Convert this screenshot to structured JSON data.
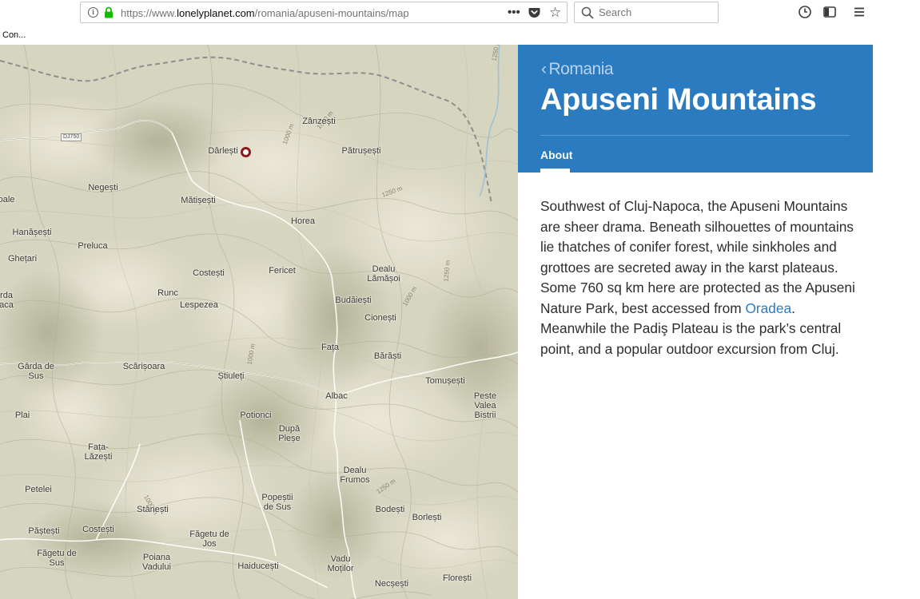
{
  "browser": {
    "url_prefix": "https://www.",
    "url_domain": "lonelyplanet.com",
    "url_path": "/romania/apuseni-mountains/map",
    "more_label": "•••",
    "search_placeholder": "Search",
    "bookmark_label": "Con..."
  },
  "map": {
    "road_label": "DJ750",
    "contour_labels": [
      "1000 m",
      "1000 m",
      "1250 m",
      "1250 m",
      "1250 m",
      "1000 m",
      "1000 m",
      "1250 m",
      "1000 m"
    ],
    "places": [
      "Zânzești",
      "Dârlești",
      "Pătrușești",
      "Negești",
      "Mătișești",
      "oale",
      "Horea",
      "Hanășești",
      "Preluca",
      "Ghețari",
      "Costești",
      "Fericet",
      "Dealu",
      "Lămășoi",
      "Runc",
      "Lespezea",
      "Budăiești",
      "Cionești",
      "rda",
      "aca",
      "Fața",
      "Bărăști",
      "Gârda de",
      "Sus",
      "Scărișoara",
      "Știuleți",
      "Tomușești",
      "Albac",
      "Peste",
      "Valea",
      "Bistrii",
      "Plai",
      "Potionci",
      "După",
      "Pleșe",
      "Fața-",
      "Lăzești",
      "Dealu",
      "Frumos",
      "Petelei",
      "Popeștii",
      "de Sus",
      "Stănești",
      "Bodești",
      "Borlești",
      "Păștești",
      "Costești",
      "Făgetu de",
      "Jos",
      "Făgetu de",
      "Sus",
      "Poiana",
      "Vadului",
      "Haiducești",
      "Vadu",
      "Moților",
      "Necșești",
      "Florești"
    ]
  },
  "panel": {
    "back_label": "Romania",
    "title": "Apuseni Mountains",
    "tab_about": "About",
    "desc_part1": "Southwest of Cluj-Napoca, the Apuseni Mountains are sheer drama. Beneath silhouettes of mountains lie thatches of conifer forest, while sinkholes and grottoes are secreted away in the karst plateaus. Some 760 sq km here are protected as the Apuseni Nature Park, best accessed from ",
    "desc_link": "Oradea",
    "desc_part2": ". Meanwhile the Padiş Plateau is the park’s central point, and a popular outdoor excursion from Cluj."
  },
  "colors": {
    "header_blue": "#2b7bc0",
    "marker_red": "#8b1a1a",
    "map_terrain": "#d8d6c2"
  }
}
